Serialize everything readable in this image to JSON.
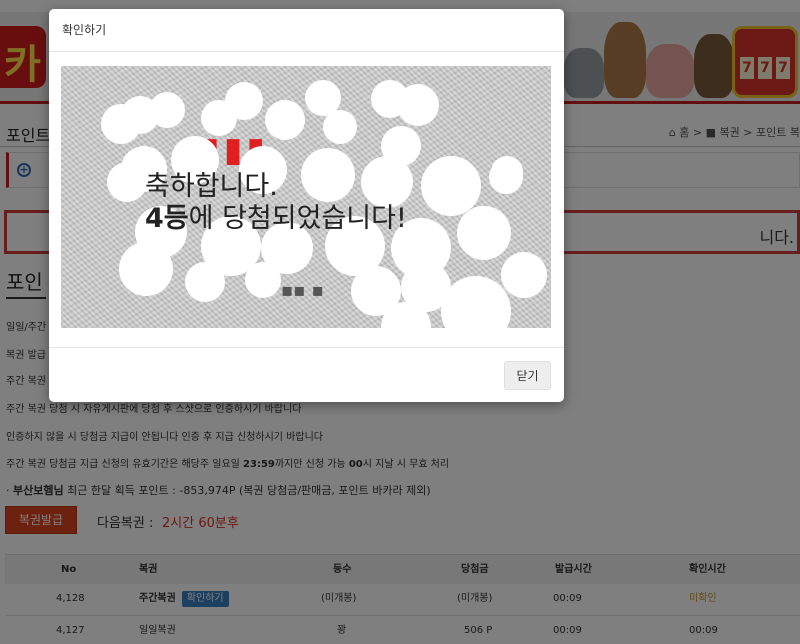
{
  "page": {
    "title": "포인트",
    "breadcrumb": {
      "home": "홈",
      "section": "복권",
      "current": "포인트 복"
    },
    "notice_text": "니다.",
    "section_title": "포인",
    "info_lines": [
      "일일/주간",
      "복권 발급",
      "주간 복권",
      "주간 복권 당첨 시 자유게시판에 당첨 후 스샷으로 인증하시기 바랍니다",
      "인증하지 않을 시 당첨금 지급이 안됩니다 인증 후 지급 신청하시기 바랍니다"
    ],
    "validity_line": {
      "prefix": "주간 복권 당첨금 지급 신청의 유효기간은 해당주 일요일 ",
      "time": "23:59",
      "middle": "까지만 신청 가능 ",
      "hour": "00",
      "suffix": "시 지날 시 무효 처리"
    },
    "user_line": {
      "bullet": "·",
      "name": "부산보헴님",
      "text": " 최근 한달 획득 포인트 : -853,974P (복권 당첨금/판매금, 포인트 바카라 제외)"
    },
    "lottery_button": "복권발급",
    "next_lottery_label": "다음복권 :",
    "next_lottery_value": "2시간 60분후",
    "table": {
      "headers": [
        "No",
        "복권",
        "등수",
        "당첨금",
        "발급시간",
        "확인시간"
      ],
      "rows": [
        {
          "no": "4,128",
          "type": "주간복권",
          "badge": "확인하기",
          "rank": "(미개봉)",
          "prize": "(미개봉)",
          "issued": "00:09",
          "confirmed": "미확인"
        },
        {
          "no": "4,127",
          "type": "일일복권",
          "badge": "",
          "rank": "꽝",
          "prize": "506 P",
          "issued": "00:09",
          "confirmed": "00:09"
        }
      ]
    }
  },
  "banner": {
    "logo_text": "카",
    "slot_symbols": [
      "7",
      "7",
      "7"
    ]
  },
  "modal": {
    "title": "확인하기",
    "message_line1": "축하합니다.",
    "message_rank": "4등",
    "message_line2": "에 당첨되었습니다!",
    "close_label": "닫기"
  },
  "colors": {
    "accent_red": "#c91f1f",
    "button_orange": "#d9441e",
    "badge_blue": "#3a7fc1",
    "unconfirmed_gold": "#c8932a"
  }
}
